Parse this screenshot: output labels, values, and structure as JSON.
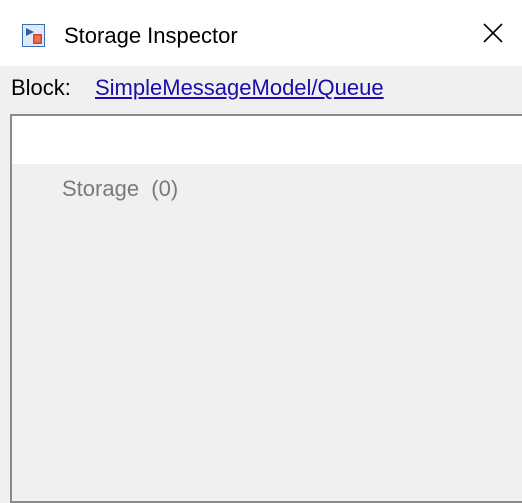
{
  "window": {
    "title": "Storage Inspector",
    "app_icon": "simulink-block-icon",
    "close_icon": "close-icon"
  },
  "block": {
    "label": "Block:",
    "path_link": "SimpleMessageModel/Queue"
  },
  "tree": {
    "items": [
      {
        "label": "Storage  (0)"
      }
    ]
  },
  "colors": {
    "link": "#1a0dab",
    "muted_text": "#7a7a7a",
    "panel_bg": "#f0f0f0",
    "border": "#8a8a8a"
  }
}
